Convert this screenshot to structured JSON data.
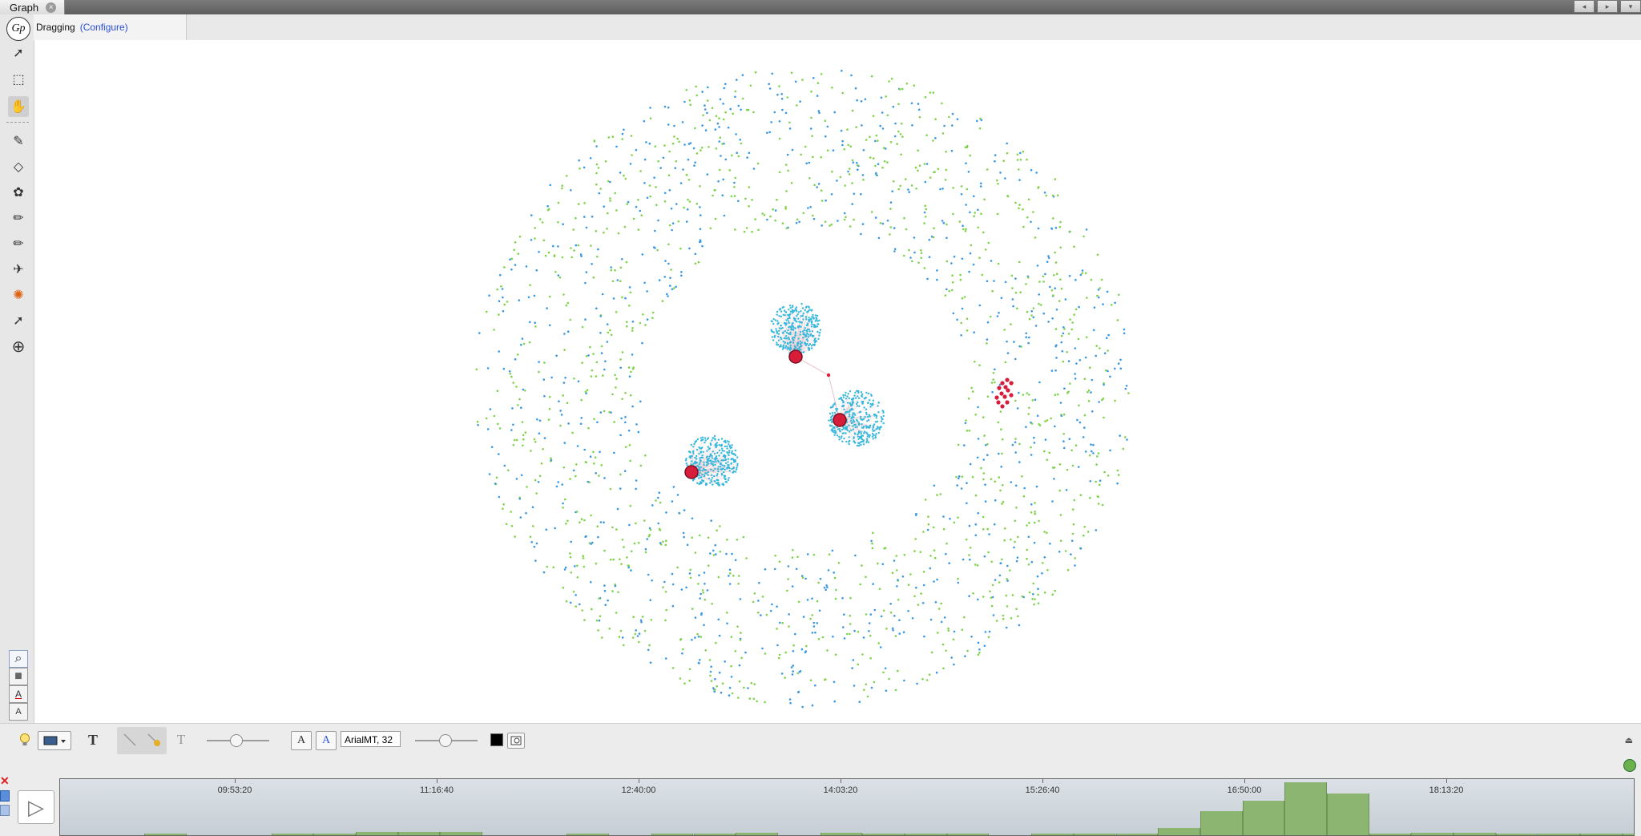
{
  "tabs": [
    {
      "label": "Graph",
      "close_glyph": "×"
    }
  ],
  "window_buttons": [
    {
      "icon": "arrow-left-icon",
      "glyph": "◂"
    },
    {
      "icon": "arrow-right-icon",
      "glyph": "▸"
    },
    {
      "icon": "dropdown-icon",
      "glyph": "▾"
    }
  ],
  "header": {
    "mode": "Dragging",
    "configure": "(Configure)"
  },
  "left_toolbar": {
    "logo": "Gp",
    "tools": [
      {
        "name": "direct-selection-tool",
        "icon": "pointer-icon",
        "glyph": "➚",
        "active": false
      },
      {
        "name": "rectangle-selection-tool",
        "icon": "rectangle-select-icon",
        "glyph": "⬚",
        "active": false
      },
      {
        "name": "drag-tool",
        "icon": "hand-icon",
        "glyph": "✋",
        "active": true
      },
      {
        "name": "painter-tool",
        "icon": "brush-icon",
        "glyph": "✎",
        "active": false
      },
      {
        "name": "size-tool",
        "icon": "diamond-icon",
        "glyph": "◇",
        "active": false
      },
      {
        "name": "heatmap-tool",
        "icon": "palette-icon",
        "glyph": "✿",
        "active": false
      },
      {
        "name": "pencil-tool",
        "icon": "pencil-icon",
        "glyph": "✏",
        "active": false
      },
      {
        "name": "edge-pencil-tool",
        "icon": "pencil-icon",
        "glyph": "✏",
        "active": false
      },
      {
        "name": "shortest-path-tool",
        "icon": "plane-icon",
        "glyph": "✈",
        "active": false
      },
      {
        "name": "diffusion-tool",
        "icon": "sun-icon",
        "glyph": "✺",
        "active": false
      },
      {
        "name": "edit-tool",
        "icon": "pointer-question-icon",
        "glyph": "➚",
        "active": false
      },
      {
        "name": "add-tool",
        "icon": "plus-circle-icon",
        "glyph": "⊕",
        "active": false
      }
    ],
    "bottom_tools": [
      {
        "name": "center-graph-button",
        "icon": "zoom-icon",
        "glyph": "⌕"
      },
      {
        "name": "background-color-button",
        "icon": "background-color-icon",
        "glyph": "■"
      },
      {
        "name": "label-color-button",
        "icon": "text-color-icon",
        "glyph": "A"
      },
      {
        "name": "label-size-button",
        "icon": "text-size-icon",
        "glyph": "A"
      }
    ]
  },
  "graph": {
    "colors": {
      "blue": "#3a98e3",
      "green": "#7fd34a",
      "cyan": "#36b8dd",
      "hub": "#d81d3b",
      "edge": "#e3c2c8"
    }
  },
  "bottom_toolbar": {
    "lightbulb_icon": "lightbulb-icon",
    "font_label": "ArialMT, 32",
    "text_glyph": "T",
    "a_minus": "A",
    "a_plus": "A",
    "node_label_color": "#000000"
  },
  "timeline": {
    "play_glyph": "▷",
    "labels": [
      "09:53:20",
      "11:16:40",
      "12:40:00",
      "14:03:20",
      "15:26:40",
      "16:50:00",
      "18:13:20"
    ],
    "histogram": [
      0,
      0,
      0.02,
      0,
      0,
      0.01,
      0.01,
      0.05,
      0.06,
      0.05,
      0,
      0,
      0.02,
      0,
      0.03,
      0.02,
      0.04,
      0,
      0.04,
      0.03,
      0.03,
      0.03,
      0,
      0.02,
      0.03,
      0.03,
      0.12,
      0.42,
      0.6,
      0.92,
      0.72,
      0.03,
      0.04,
      0.04,
      0.03,
      0.03,
      0.03,
      0.02,
      0.02,
      0.02,
      0.02,
      0.01,
      0.01,
      0.01,
      0.01,
      0,
      0.01
    ]
  }
}
